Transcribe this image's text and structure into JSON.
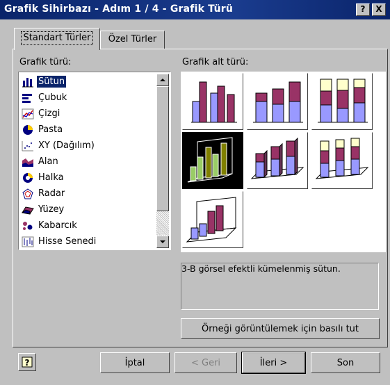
{
  "window": {
    "title": "Grafik Sihirbazı - Adım 1 / 4 - Grafik Türü",
    "help_btn": "?",
    "close_btn": "X"
  },
  "tabs": [
    {
      "label": "Standart Türler",
      "active": true
    },
    {
      "label": "Özel Türler",
      "active": false
    }
  ],
  "chart_type": {
    "label": "Grafik türü:",
    "items": [
      {
        "label": "Sütun",
        "icon": "column-chart-icon",
        "selected": true
      },
      {
        "label": "Çubuk",
        "icon": "bar-chart-icon"
      },
      {
        "label": "Çizgi",
        "icon": "line-chart-icon"
      },
      {
        "label": "Pasta",
        "icon": "pie-chart-icon"
      },
      {
        "label": "XY (Dağılım)",
        "icon": "scatter-chart-icon"
      },
      {
        "label": "Alan",
        "icon": "area-chart-icon"
      },
      {
        "label": "Halka",
        "icon": "doughnut-chart-icon"
      },
      {
        "label": "Radar",
        "icon": "radar-chart-icon"
      },
      {
        "label": "Yüzey",
        "icon": "surface-chart-icon"
      },
      {
        "label": "Kabarcık",
        "icon": "bubble-chart-icon"
      },
      {
        "label": "Hisse Senedi",
        "icon": "stock-chart-icon"
      }
    ]
  },
  "subtype": {
    "label": "Grafik alt türü:",
    "description": "3-B görsel efektli kümelenmiş sütun.",
    "selected_index": 3
  },
  "preview_btn": "Örneği görüntülemek için basılı tut",
  "buttons": {
    "cancel": "İptal",
    "back": "< Geri",
    "next": "İleri >",
    "finish": "Son"
  },
  "colors": {
    "purple": "#993366",
    "blue": "#9999ff",
    "yellow": "#ffffcc",
    "olive": "#808000",
    "green": "#99cc66",
    "titlebar": "#0a246a"
  }
}
